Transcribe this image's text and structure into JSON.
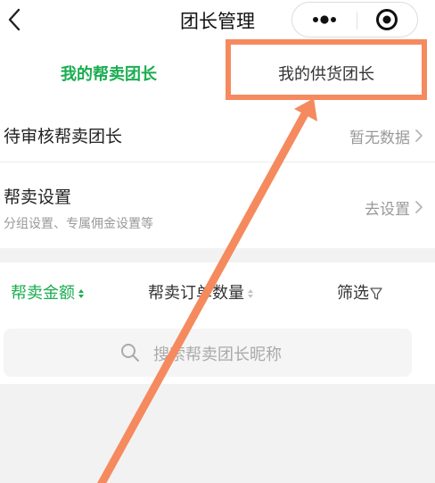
{
  "header": {
    "title": "团长管理",
    "back_icon": "chevron-left-icon",
    "more_icon": "more-dots-icon",
    "target_icon": "target-icon"
  },
  "tabs": [
    {
      "label": "我的帮卖团长",
      "active": true
    },
    {
      "label": "我的供货团长",
      "active": false
    }
  ],
  "rows": [
    {
      "title": "待审核帮卖团长",
      "value": "暂无数据"
    },
    {
      "title": "帮卖设置",
      "subtitle": "分组设置、专属佣金设置等",
      "value": "去设置"
    }
  ],
  "filters": [
    {
      "label": "帮卖金额",
      "active": true
    },
    {
      "label": "帮卖订单数量",
      "active": false
    },
    {
      "label": "筛选",
      "active": false
    }
  ],
  "search": {
    "placeholder": "搜索帮卖团长昵称"
  },
  "colors": {
    "accent": "#1aad50",
    "annotation": "#f58a5e"
  }
}
